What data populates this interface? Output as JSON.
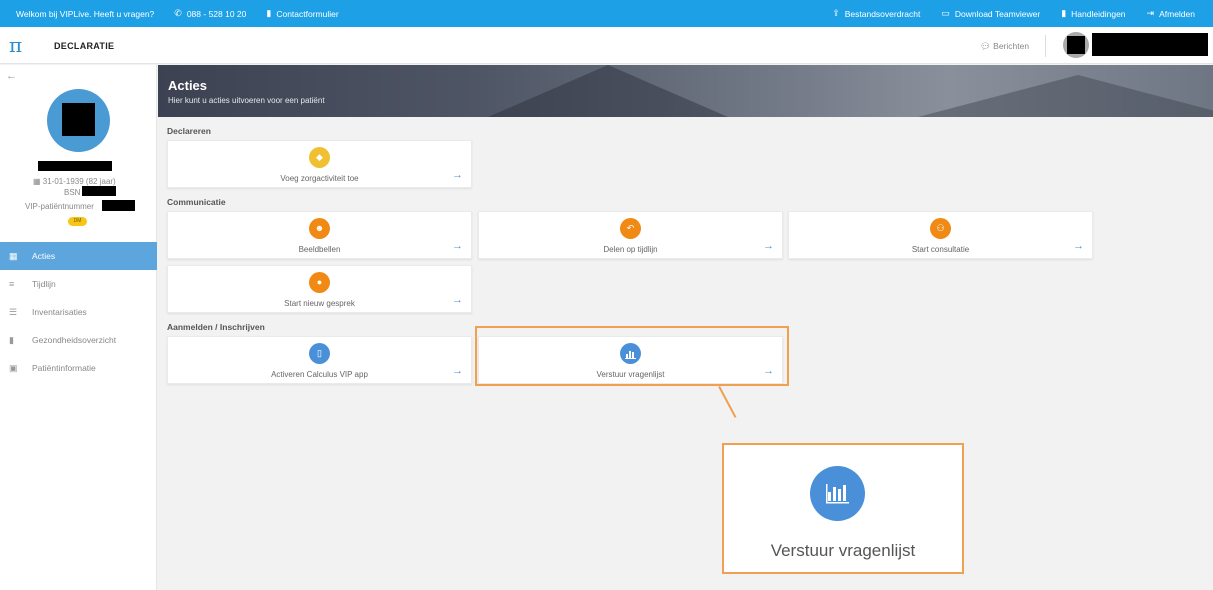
{
  "topbar": {
    "welcome": "Welkom bij VIPLive. Heeft u vragen?",
    "phone": "088 - 528 10 20",
    "contact": "Contactformulier",
    "file_transfer": "Bestandsoverdracht",
    "teamviewer": "Download Teamviewer",
    "manuals": "Handleidingen",
    "logout": "Afmelden",
    "bg_color": "#1ea0e6"
  },
  "header": {
    "logo": "π",
    "title": "DECLARATIE",
    "messages": "Berichten"
  },
  "patient": {
    "birth": "31-01-1939 (82 jaar)",
    "bsn_label": "BSN",
    "vip_label": "VIP-patiëntnummer",
    "badge": "DM"
  },
  "sidebar": {
    "items": [
      {
        "label": "Acties",
        "icon": "calendar-icon",
        "active": true
      },
      {
        "label": "Tijdlijn",
        "icon": "list-icon",
        "active": false
      },
      {
        "label": "Inventarisaties",
        "icon": "checklist-icon",
        "active": false
      },
      {
        "label": "Gezondheidsoverzicht",
        "icon": "document-icon",
        "active": false
      },
      {
        "label": "Patiëntinformatie",
        "icon": "id-card-icon",
        "active": false
      }
    ]
  },
  "banner": {
    "title": "Acties",
    "subtitle": "Hier kunt u acties uitvoeren voor een patiënt"
  },
  "sections": {
    "declareren": "Declareren",
    "communicatie": "Communicatie",
    "aanmelden": "Aanmelden / Inschrijven"
  },
  "cards": {
    "zorgactiviteit": "Voeg zorgactiviteit toe",
    "beeldbellen": "Beeldbellen",
    "delen": "Delen op tijdlijn",
    "consultatie": "Start consultatie",
    "gesprek": "Start nieuw gesprek",
    "calculus": "Activeren Calculus VIP app",
    "vragenlijst": "Verstuur vragenlijst"
  },
  "zoom": {
    "label": "Verstuur vragenlijst"
  },
  "colors": {
    "accent_blue": "#4a90d9",
    "orange": "#f08a14",
    "yellow": "#f0c030",
    "highlight": "#f0a050"
  }
}
